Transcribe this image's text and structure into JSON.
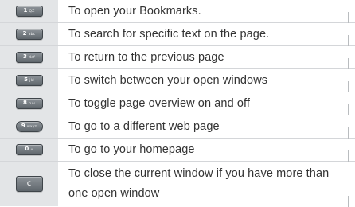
{
  "rows": [
    {
      "key": "1",
      "key_sub": "QZ",
      "text": "To open your Bookmarks."
    },
    {
      "key": "2",
      "key_sub": "abc",
      "text": "To search for specific text on the page."
    },
    {
      "key": "3",
      "key_sub": "def",
      "text": "To return to the previous page"
    },
    {
      "key": "5",
      "key_sub": "jkl",
      "text": "To switch between your open windows"
    },
    {
      "key": "8",
      "key_sub": "tuv",
      "text": "To toggle page overview on and off"
    },
    {
      "key": "9",
      "key_sub": "wxyz",
      "text": "To go to a different web page"
    },
    {
      "key": "0",
      "key_sub": "⌂",
      "text": "To go to your homepage"
    },
    {
      "key": "c",
      "key_sub": "",
      "text": "To close the current window if you have more than one open window"
    }
  ],
  "icons": {
    "key_button": "phone-keypad-key-icon",
    "clear_button": "clear-key-icon"
  },
  "colors": {
    "key_column_bg": "#e3e5e7",
    "row_divider": "#d4d6d9",
    "text": "#333333",
    "key_fill": "#6d7379"
  }
}
